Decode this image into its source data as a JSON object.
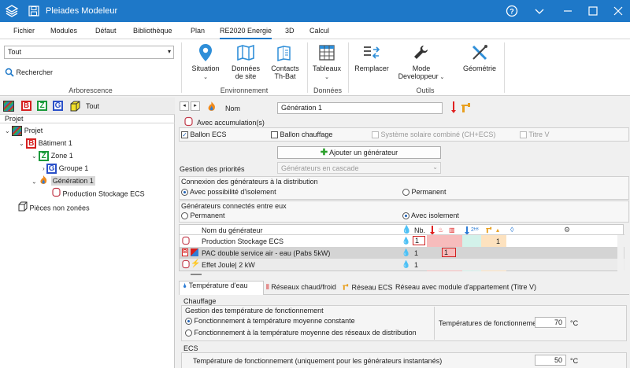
{
  "window": {
    "title": "Pleiades Modeleur"
  },
  "menu": [
    "Fichier",
    "Modules",
    "Défaut",
    "Bibliothèque",
    "Plan",
    "RE2020 Energie",
    "3D",
    "Calcul"
  ],
  "ribbon": {
    "filter_value": "Tout",
    "search_label": "Rechercher",
    "arborescence_label": "Arborescence",
    "situation": "Situation",
    "donnees_site_1": "Données",
    "donnees_site_2": "de site",
    "contacts_1": "Contacts",
    "contacts_2": "Th-Bat",
    "environnement_label": "Environnement",
    "tableaux": "Tableaux",
    "donnees_label": "Données",
    "remplacer": "Remplacer",
    "mode_dev_1": "Mode",
    "mode_dev_2": "Developpeur",
    "geometrie": "Géométrie",
    "outils_label": "Outils"
  },
  "tree": {
    "filter_all": "Tout",
    "projet_header": "Projet",
    "items": [
      {
        "label": "Projet"
      },
      {
        "label": "Bâtiment 1"
      },
      {
        "label": "Zone 1"
      },
      {
        "label": "Groupe 1"
      },
      {
        "label": "Génération 1"
      },
      {
        "label": "Production Stockage ECS"
      },
      {
        "label": "Pièces non zonées"
      }
    ]
  },
  "form": {
    "nom_label": "Nom",
    "nom_value": "Génération 1",
    "avec_accumulation": "Avec accumulation(s)",
    "ballon_ecs": "Ballon ECS",
    "ballon_chauffage": "Ballon chauffage",
    "systeme_solaire": "Système solaire combiné (CH+ECS)",
    "titre_v": "Titre V",
    "ajouter_generateur": "Ajouter un générateur",
    "gestion_priorites": "Gestion des priorités",
    "gestion_value": "Générateurs en cascade",
    "connexion_label": "Connexion des générateurs à la distribution",
    "avec_isolement": "Avec possibilité d'isolement",
    "permanent": "Permanent",
    "connectes_label": "Générateurs connectés entre eux",
    "permanent2": "Permanent",
    "avec_isolement2": "Avec isolement"
  },
  "table": {
    "col_name": "Nom du générateur",
    "col_nb": "Nb.",
    "col_2eb": "2ᴱᴮ",
    "rows": [
      {
        "name": "Production Stockage ECS",
        "nb": "1",
        "ecs": "1"
      },
      {
        "name": "PAC double service air - eau (Pabs 5kW)",
        "nb": "1",
        "ch": "1"
      },
      {
        "name": "Effet Joule| 2 kW",
        "nb": "1",
        "ch": ""
      }
    ]
  },
  "tabs": [
    "Température d'eau",
    "Réseaux chaud/froid",
    "Réseau ECS",
    "Réseau avec module d'appartement (Titre V)"
  ],
  "temp": {
    "chauffage_label": "Chauffage",
    "gestion_temp_label": "Gestion des température de fonctionnement",
    "opt1": "Fonctionnement à température moyenne constante",
    "opt2": "Fonctionnement à la température moyenne des réseaux de distribution",
    "temp_fonct_label": "Températures de fonctionnement",
    "temp_value": "70",
    "unit": "°C",
    "ecs_label": "ECS",
    "ecs_temp_label": "Température de fonctionnement (uniquement pour les générateurs instantanés)",
    "ecs_value": "50",
    "ecs_unit": "°C"
  }
}
